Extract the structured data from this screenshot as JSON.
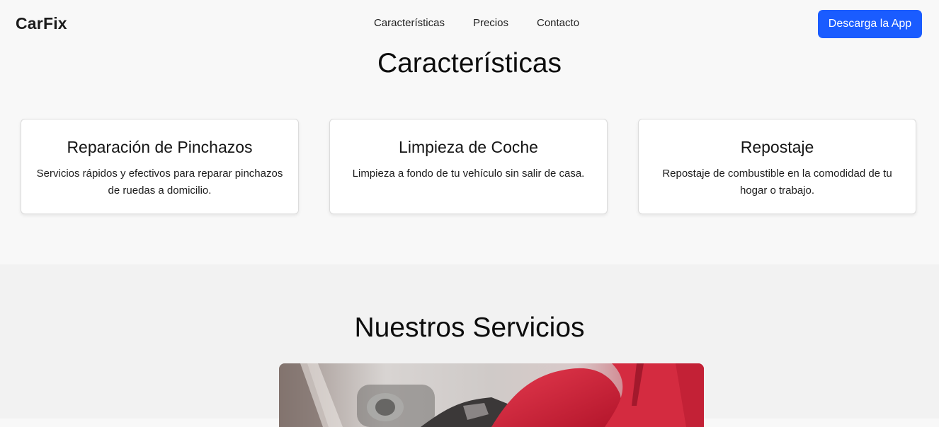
{
  "header": {
    "logo": "CarFix",
    "nav": [
      {
        "label": "Características"
      },
      {
        "label": "Precios"
      },
      {
        "label": "Contacto"
      }
    ],
    "cta_label": "Descarga la App",
    "accent_color": "#1a5cff"
  },
  "features": {
    "title": "Características",
    "cards": [
      {
        "title": "Reparación de Pinchazos",
        "description": "Servicios rápidos y efectivos para reparar pinchazos de ruedas a domicilio."
      },
      {
        "title": "Limpieza de Coche",
        "description": "Limpieza a fondo de tu vehículo sin salir de casa."
      },
      {
        "title": "Repostaje",
        "description": "Repostaje de combustible en la comodidad de tu hogar o trabajo."
      }
    ]
  },
  "services": {
    "title": "Nuestros Servicios",
    "image_icon": "fuel-pump-photo"
  }
}
